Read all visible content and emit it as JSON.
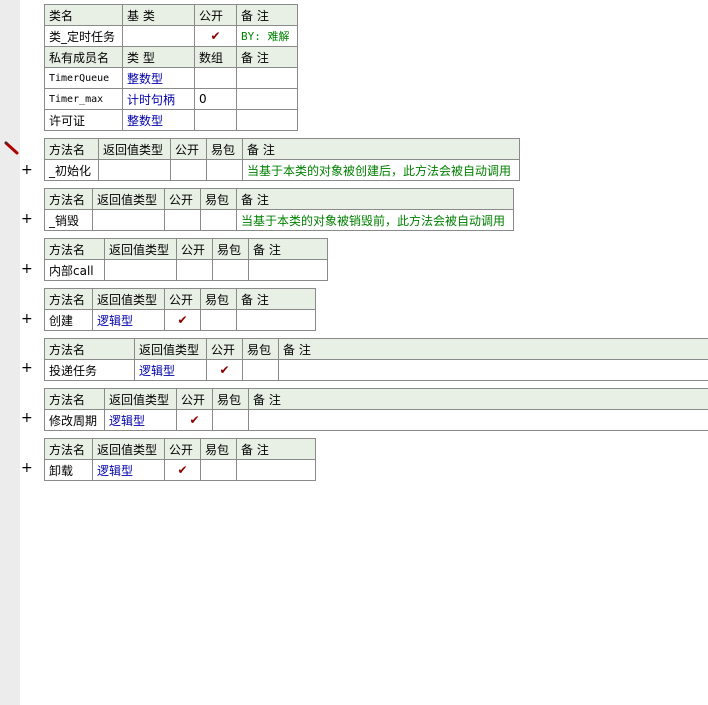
{
  "class_table": {
    "header": {
      "name": "类名",
      "base": "基 类",
      "public": "公开",
      "note": "备 注"
    },
    "row": {
      "name": "类_定时任务",
      "base": "",
      "public_check": "✔",
      "note": "BY: 难解"
    },
    "member_header": {
      "name": "私有成员名",
      "type": "类 型",
      "array": "数组",
      "note": "备 注"
    },
    "members": [
      {
        "name": "TimerQueue",
        "type": "整数型",
        "array": "",
        "note": ""
      },
      {
        "name": "Timer_max",
        "type": "计时句柄",
        "array": "0",
        "note": ""
      },
      {
        "name": "许可证",
        "type": "整数型",
        "array": "",
        "note": ""
      }
    ]
  },
  "method_header": {
    "name": "方法名",
    "return": "返回值类型",
    "public": "公开",
    "easy": "易包",
    "note": "备 注"
  },
  "methods": [
    {
      "name": "_初始化",
      "return": "",
      "public_check": "",
      "easy": "",
      "note": "当基于本类的对象被创建后，此方法会被自动调用"
    },
    {
      "name": "_销毁",
      "return": "",
      "public_check": "",
      "easy": "",
      "note": "当基于本类的对象被销毁前，此方法会被自动调用"
    },
    {
      "name": "内部call",
      "return": "",
      "public_check": "",
      "easy": "",
      "note": ""
    },
    {
      "name": "创建",
      "return": "逻辑型",
      "public_check": "✔",
      "easy": "",
      "note": ""
    },
    {
      "name": "投递任务",
      "return": "逻辑型",
      "public_check": "✔",
      "easy": "",
      "note": ""
    },
    {
      "name": "修改周期",
      "return": "逻辑型",
      "public_check": "✔",
      "easy": "",
      "note": ""
    },
    {
      "name": "卸载",
      "return": "逻辑型",
      "public_check": "✔",
      "easy": "",
      "note": ""
    }
  ],
  "expand_symbol": "+",
  "icons": {
    "edit": "pencil-icon"
  },
  "colors": {
    "type_text": "#0000aa",
    "note_text": "#008000",
    "check": "#8b0000",
    "header_bg": "#e8f0e5",
    "gutter": "#ececec"
  }
}
